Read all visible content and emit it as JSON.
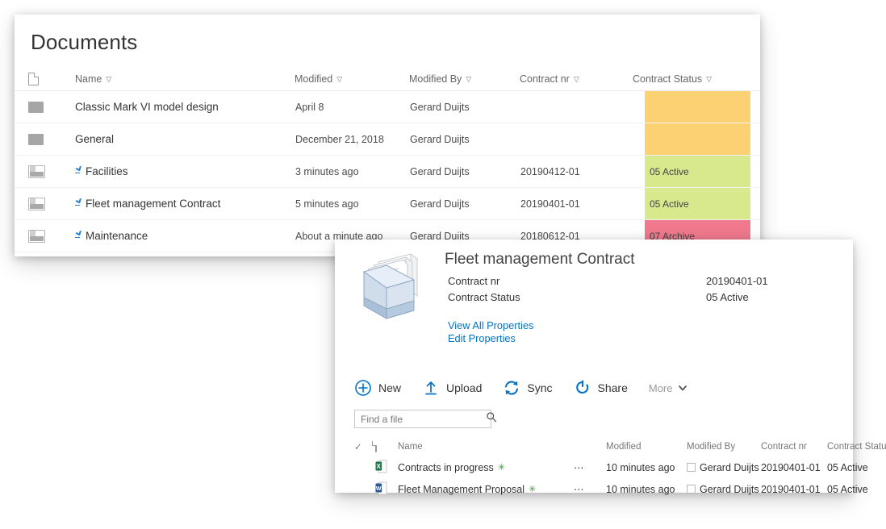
{
  "library": {
    "title": "Documents",
    "columns": [
      {
        "label": "Name",
        "sortable": true
      },
      {
        "label": "Modified",
        "sortable": true
      },
      {
        "label": "Modified By",
        "sortable": true
      },
      {
        "label": "Contract nr",
        "sortable": true
      },
      {
        "label": "Contract Status",
        "sortable": true
      }
    ],
    "type_column_icon": "document-icon",
    "rows": [
      {
        "icon": "folder-icon",
        "is_new": false,
        "name": "Classic Mark VI model design",
        "modified": "April 8",
        "modified_by": "Gerard Duijts",
        "contract_nr": "",
        "contract_status": "",
        "status_color": "#fbd173"
      },
      {
        "icon": "folder-icon",
        "is_new": false,
        "name": "General",
        "modified": "December 21, 2018",
        "modified_by": "Gerard Duijts",
        "contract_nr": "",
        "contract_status": "",
        "status_color": "#fbd173"
      },
      {
        "icon": "document-set-icon",
        "is_new": true,
        "name": "Facilities",
        "modified": "3 minutes ago",
        "modified_by": "Gerard Duijts",
        "contract_nr": "20190412-01",
        "contract_status": "05 Active",
        "status_color": "#d7e98c"
      },
      {
        "icon": "document-set-icon",
        "is_new": true,
        "name": "Fleet management Contract",
        "modified": "5 minutes ago",
        "modified_by": "Gerard Duijts",
        "contract_nr": "20190401-01",
        "contract_status": "05 Active",
        "status_color": "#d7e98c"
      },
      {
        "icon": "document-set-icon",
        "is_new": true,
        "name": "Maintenance",
        "modified": "About a minute ago",
        "modified_by": "Gerard Duijts",
        "contract_nr": "20180612-01",
        "contract_status": "07 Archive",
        "status_color": "#f0798d"
      }
    ]
  },
  "detail": {
    "icon": "document-set-large-icon",
    "title": "Fleet management Contract",
    "properties": [
      {
        "key": "Contract nr",
        "value": "20190401-01"
      },
      {
        "key": "Contract Status",
        "value": "05 Active"
      }
    ],
    "links": [
      {
        "label": "View All Properties"
      },
      {
        "label": "Edit Properties"
      }
    ],
    "link_color": "#0272c5",
    "commands": [
      {
        "label": "New",
        "icon": "plus-circle-icon"
      },
      {
        "label": "Upload",
        "icon": "upload-arrow-icon"
      },
      {
        "label": "Sync",
        "icon": "sync-icon"
      },
      {
        "label": "Share",
        "icon": "share-icon"
      },
      {
        "label": "More",
        "icon": "chevron-down-icon"
      }
    ],
    "search": {
      "placeholder": "Find a file",
      "value": "",
      "icon": "search-icon"
    },
    "file_list": {
      "select_all_icon": "checkmark-icon",
      "type_icon": "document-icon",
      "columns": [
        {
          "label": "Name"
        },
        {
          "label": "Modified"
        },
        {
          "label": "Modified By"
        },
        {
          "label": "Contract nr"
        },
        {
          "label": "Contract Status"
        }
      ],
      "rows": [
        {
          "icon": "excel-file-icon",
          "name": "Contracts in progress",
          "new_badge": "✳",
          "menu_icon": "ellipsis-icon",
          "modified": "10 minutes ago",
          "modified_by": "Gerard Duijts",
          "contract_nr": "20190401-01",
          "contract_status": "05 Active"
        },
        {
          "icon": "word-file-icon",
          "name": "Fleet Management Proposal",
          "new_badge": "✳",
          "menu_icon": "ellipsis-icon",
          "modified": "10 minutes ago",
          "modified_by": "Gerard Duijts",
          "contract_nr": "20190401-01",
          "contract_status": "05 Active"
        }
      ]
    }
  },
  "colors": {
    "accent_blue": "#0272c5",
    "status_amber": "#fbd173",
    "status_green": "#d7e98c",
    "status_red": "#f0798d",
    "excel_green": "#1f7244",
    "word_blue": "#2a5699"
  }
}
